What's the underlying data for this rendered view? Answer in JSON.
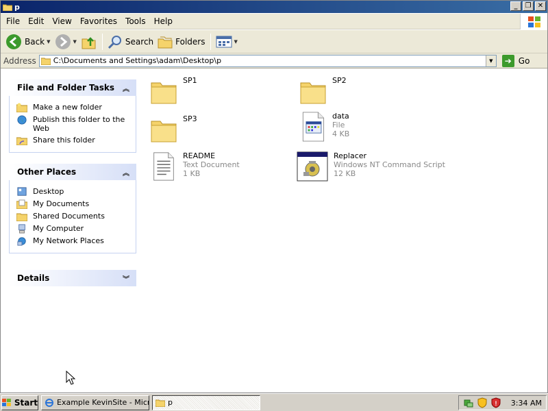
{
  "window": {
    "title": "p"
  },
  "menu": [
    "File",
    "Edit",
    "View",
    "Favorites",
    "Tools",
    "Help"
  ],
  "toolbar": {
    "back": "Back",
    "search": "Search",
    "folders": "Folders"
  },
  "address": {
    "label": "Address",
    "value": "C:\\Documents and Settings\\adam\\Desktop\\p",
    "go": "Go"
  },
  "tasks": {
    "title": "File and Folder Tasks",
    "items": [
      "Make a new folder",
      "Publish this folder to the Web",
      "Share this folder"
    ]
  },
  "places": {
    "title": "Other Places",
    "items": [
      "Desktop",
      "My Documents",
      "Shared Documents",
      "My Computer",
      "My Network Places"
    ]
  },
  "details": {
    "title": "Details"
  },
  "files": [
    {
      "name": "SP1",
      "type": "",
      "size": "",
      "icon": "folder-icon"
    },
    {
      "name": "SP2",
      "type": "",
      "size": "",
      "icon": "folder-icon"
    },
    {
      "name": "SP3",
      "type": "",
      "size": "",
      "icon": "folder-icon"
    },
    {
      "name": "data",
      "type": "File",
      "size": "4 KB",
      "icon": "generic-file-icon"
    },
    {
      "name": "README",
      "type": "Text Document",
      "size": "1 KB",
      "icon": "text-document-icon"
    },
    {
      "name": "Replacer",
      "type": "Windows NT Command Script",
      "size": "12 KB",
      "icon": "command-script-icon"
    }
  ],
  "taskbar": {
    "start": "Start",
    "tasks": [
      "Example KevinSite - Micr...",
      "p"
    ],
    "clock": "3:34 AM"
  },
  "colors": {
    "titlebar": "#0a246a",
    "taskbar": "#d4d0c8",
    "panel_header": "#d6dff7"
  }
}
